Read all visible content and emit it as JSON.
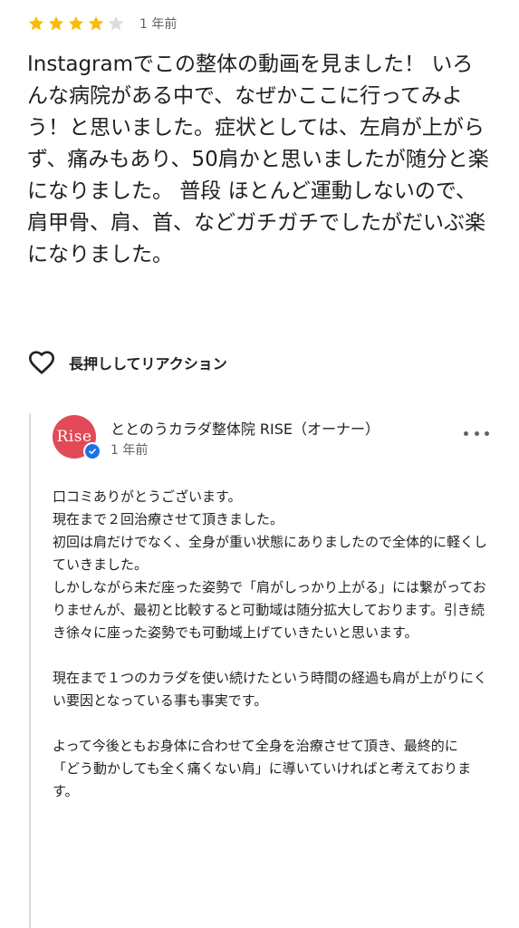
{
  "review": {
    "rating": 4,
    "rating_max": 5,
    "time": "1 年前",
    "text": "Instagramでこの整体の動画を見ました！ いろんな病院がある中で、なぜかここに行ってみよう！と思いました。症状としては、左肩が上がらず、痛みもあり、50肩かと思いましたが随分と楽になりました。 普段 ほとんど運動しないので、肩甲骨、肩、首、などガチガチでしたがだいぶ楽になりました。",
    "reaction_label": "長押ししてリアクション"
  },
  "owner": {
    "name": "ととのうカラダ整体院 RISE（オーナー）",
    "time": "1 年前",
    "logo_text": "Rise",
    "reply": "口コミありがとうございます。\n現在まで２回治療させて頂きました。\n初回は肩だけでなく、全身が重い状態にありましたので全体的に軽くしていきました。\nしかしながら未だ座った姿勢で「肩がしっかり上がる」には繋がっておりませんが、最初と比較すると可動域は随分拡大しております。引き続き徐々に座った姿勢でも可動域上げていきたいと思います。\n\n現在まで１つのカラダを使い続けたという時間の経過も肩が上がりにくい要因となっている事も事実です。\n\nよって今後ともお身体に合わせて全身を治療させて頂き、最終的に\n「どう動かしても全く痛くない肩」に導いていければと考えております。"
  },
  "colors": {
    "star_filled": "#fbbc04",
    "star_empty": "#dadce0",
    "avatar_bg": "#e24a58",
    "verified": "#1a73e8"
  },
  "icons": {
    "star": "star-icon",
    "heart": "heart-outline-icon",
    "verified": "verified-check-icon",
    "more": "more-horizontal-icon"
  }
}
